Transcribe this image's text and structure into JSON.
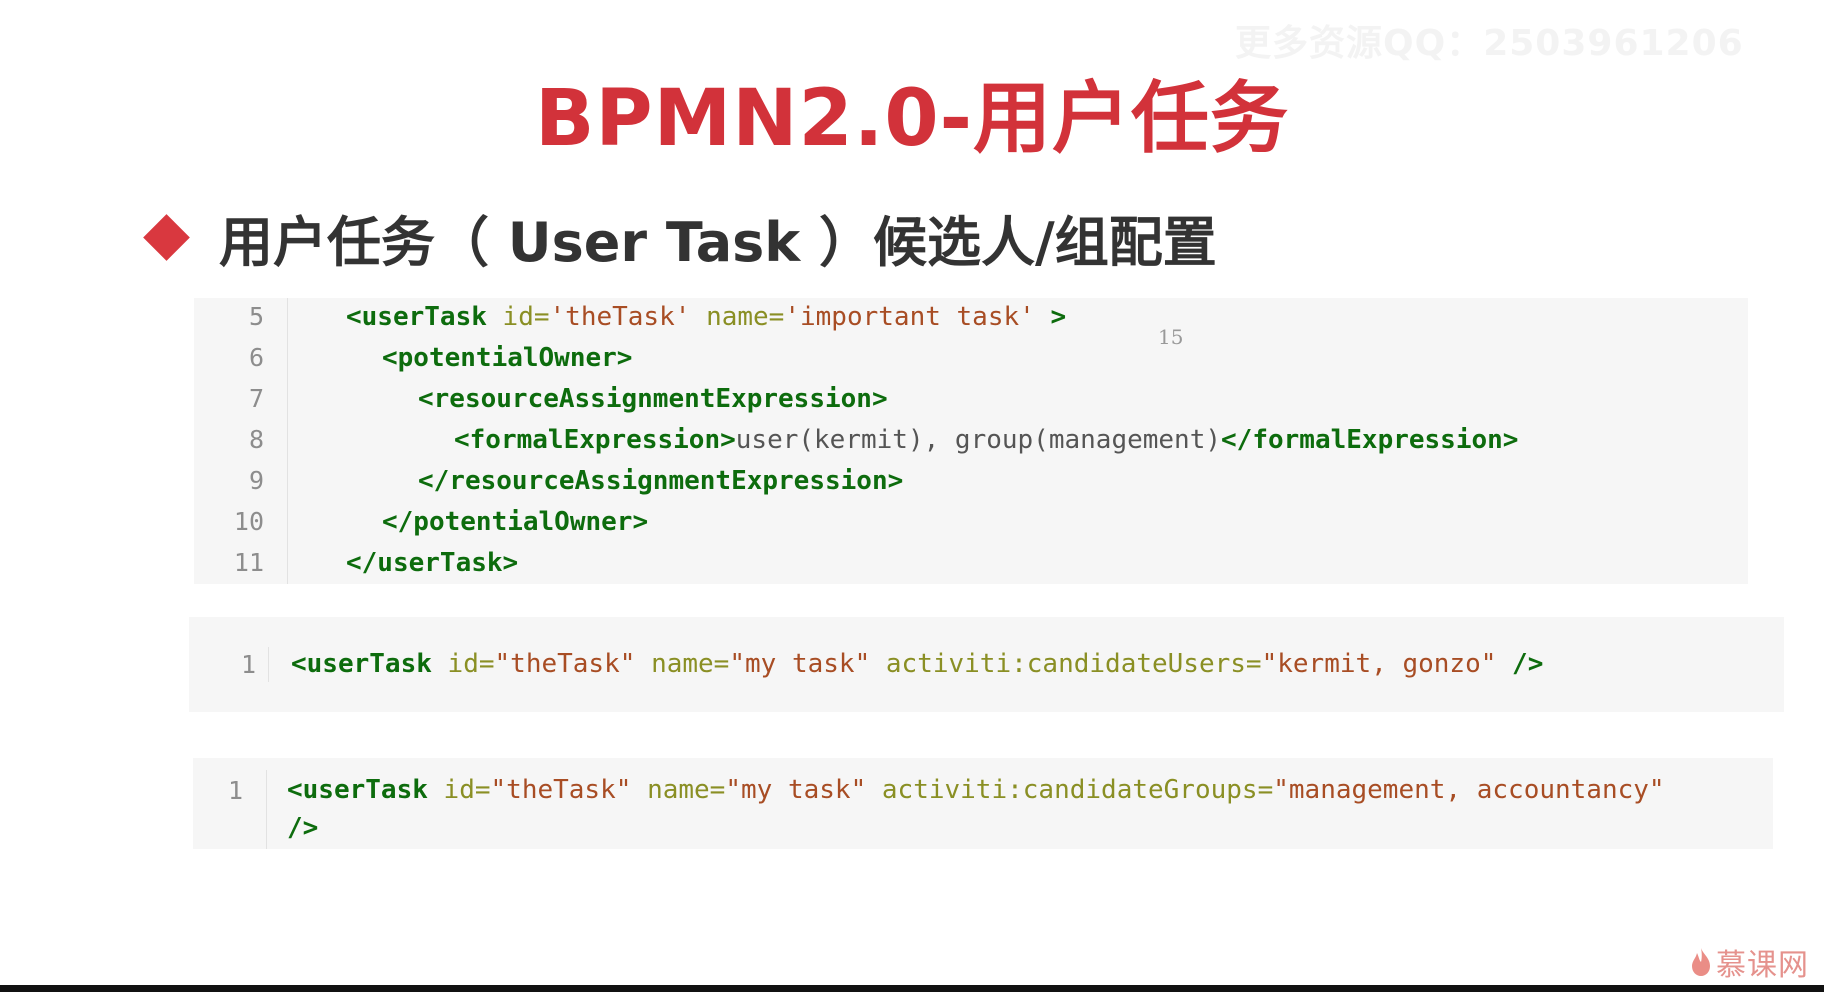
{
  "watermark": "更多资源QQ：2503961206",
  "title": "BPMN2.0-用户任务",
  "subtitle": "用户任务（ User Task ）候选人/组配置",
  "code1": {
    "line_numbers": [
      "5",
      "6",
      "7",
      "8",
      "9",
      "10",
      "11"
    ],
    "l5": {
      "open": "<userTask",
      "a1": "id=",
      "v1": "'theTask'",
      "a2": "name=",
      "v2": "'important task'",
      "close": ">"
    },
    "l6": "<potentialOwner>",
    "l7": "<resourceAssignmentExpression>",
    "l8": {
      "open": "<formalExpression>",
      "text": "user(kermit), group(management)",
      "close": "</formalExpression>"
    },
    "l9": "</resourceAssignmentExpression>",
    "l10": "</potentialOwner>",
    "l11": "</userTask>",
    "overlay_number": "15"
  },
  "code2": {
    "line_number": "1",
    "open": "<userTask",
    "a1": "id=",
    "v1": "\"theTask\"",
    "a2": "name=",
    "v2": "\"my task\"",
    "a3": "activiti:candidateUsers=",
    "v3": "\"kermit, gonzo\"",
    "close": "/>"
  },
  "code3": {
    "line_number": "1",
    "open": "<userTask",
    "a1": "id=",
    "v1": "\"theTask\"",
    "a2": "name=",
    "v2": "\"my task\"",
    "a3": "activiti:candidateGroups=",
    "v3": "\"management, accountancy\"",
    "close": "/>"
  },
  "logo": {
    "text": "慕课网",
    "icon": "flame-icon"
  },
  "colors": {
    "title": "#d2323a",
    "tag": "#0d6c0d",
    "attr": "#8a8f24",
    "string": "#a84d24",
    "code_bg": "#f6f6f6"
  }
}
